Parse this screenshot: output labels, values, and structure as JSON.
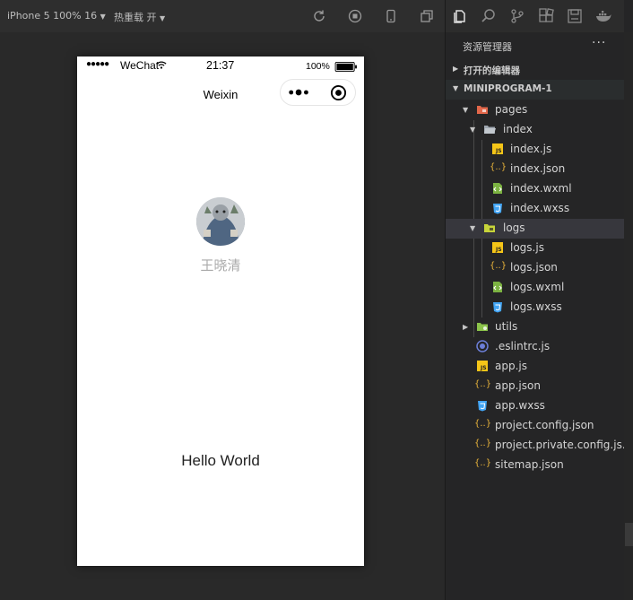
{
  "toolbar": {
    "device": "iPhone 5 100% 16",
    "hot_reload": "热重载 开"
  },
  "phone": {
    "signal": "●●●●●",
    "carrier": "WeChat",
    "time": "21:37",
    "battery": "100%",
    "nav_title": "Weixin",
    "user_name": "王晓清",
    "motto": "Hello World"
  },
  "explorer": {
    "title": "资源管理器",
    "more": "···",
    "open_editors": "打开的编辑器",
    "project": "MINIPROGRAM-1",
    "files": [
      {
        "name": "pages",
        "type": "folder-open"
      },
      {
        "name": "index",
        "type": "folder-open"
      },
      {
        "name": "index.js",
        "type": "js"
      },
      {
        "name": "index.json",
        "type": "json"
      },
      {
        "name": "index.wxml",
        "type": "wxml"
      },
      {
        "name": "index.wxss",
        "type": "wxss"
      },
      {
        "name": "logs",
        "type": "folder-open"
      },
      {
        "name": "logs.js",
        "type": "js"
      },
      {
        "name": "logs.json",
        "type": "json"
      },
      {
        "name": "logs.wxml",
        "type": "wxml"
      },
      {
        "name": "logs.wxss",
        "type": "wxss"
      },
      {
        "name": "utils",
        "type": "folder"
      },
      {
        "name": ".eslintrc.js",
        "type": "eslint"
      },
      {
        "name": "app.js",
        "type": "js"
      },
      {
        "name": "app.json",
        "type": "json"
      },
      {
        "name": "app.wxss",
        "type": "wxss"
      },
      {
        "name": "project.config.json",
        "type": "json"
      },
      {
        "name": "project.private.config.js...",
        "type": "json"
      },
      {
        "name": "sitemap.json",
        "type": "json"
      }
    ]
  },
  "colors": {
    "js": "#f5c518",
    "json": "#e8b33a",
    "wxml": "#7cb342",
    "wxss": "#42a5f5",
    "folder_pages": "#e2674a",
    "folder_utils": "#8bc34a",
    "folder_logs": "#c7d43a",
    "eslint": "#6c7fd8"
  }
}
